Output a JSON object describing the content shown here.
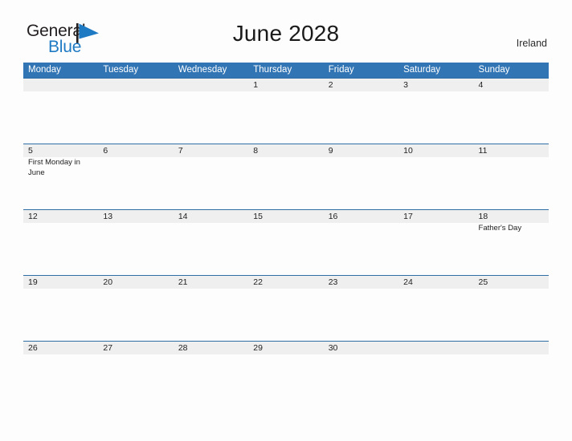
{
  "logo": {
    "word_primary": "General",
    "word_secondary": "Blue",
    "icon": "flag-triangle-icon",
    "primary_color": "#231f20",
    "secondary_color": "#1f7ac4"
  },
  "header": {
    "title": "June 2028",
    "country": "Ireland"
  },
  "theme": {
    "header_blue": "#3275b4",
    "row_divider_blue": "#2f6ea5",
    "date_band_gray": "#efefef",
    "page_background": "#fdfdfd",
    "text_dark": "#222222"
  },
  "calendar": {
    "month": "June",
    "year": "2028",
    "weekday_headers": [
      "Monday",
      "Tuesday",
      "Wednesday",
      "Thursday",
      "Friday",
      "Saturday",
      "Sunday"
    ],
    "weeks": [
      {
        "days": [
          {
            "date": "",
            "event": ""
          },
          {
            "date": "",
            "event": ""
          },
          {
            "date": "",
            "event": ""
          },
          {
            "date": "1",
            "event": ""
          },
          {
            "date": "2",
            "event": ""
          },
          {
            "date": "3",
            "event": ""
          },
          {
            "date": "4",
            "event": ""
          }
        ]
      },
      {
        "days": [
          {
            "date": "5",
            "event": "First Monday in June"
          },
          {
            "date": "6",
            "event": ""
          },
          {
            "date": "7",
            "event": ""
          },
          {
            "date": "8",
            "event": ""
          },
          {
            "date": "9",
            "event": ""
          },
          {
            "date": "10",
            "event": ""
          },
          {
            "date": "11",
            "event": ""
          }
        ]
      },
      {
        "days": [
          {
            "date": "12",
            "event": ""
          },
          {
            "date": "13",
            "event": ""
          },
          {
            "date": "14",
            "event": ""
          },
          {
            "date": "15",
            "event": ""
          },
          {
            "date": "16",
            "event": ""
          },
          {
            "date": "17",
            "event": ""
          },
          {
            "date": "18",
            "event": "Father's Day"
          }
        ]
      },
      {
        "days": [
          {
            "date": "19",
            "event": ""
          },
          {
            "date": "20",
            "event": ""
          },
          {
            "date": "21",
            "event": ""
          },
          {
            "date": "22",
            "event": ""
          },
          {
            "date": "23",
            "event": ""
          },
          {
            "date": "24",
            "event": ""
          },
          {
            "date": "25",
            "event": ""
          }
        ]
      },
      {
        "days": [
          {
            "date": "26",
            "event": ""
          },
          {
            "date": "27",
            "event": ""
          },
          {
            "date": "28",
            "event": ""
          },
          {
            "date": "29",
            "event": ""
          },
          {
            "date": "30",
            "event": ""
          },
          {
            "date": "",
            "event": ""
          },
          {
            "date": "",
            "event": ""
          }
        ]
      }
    ]
  }
}
